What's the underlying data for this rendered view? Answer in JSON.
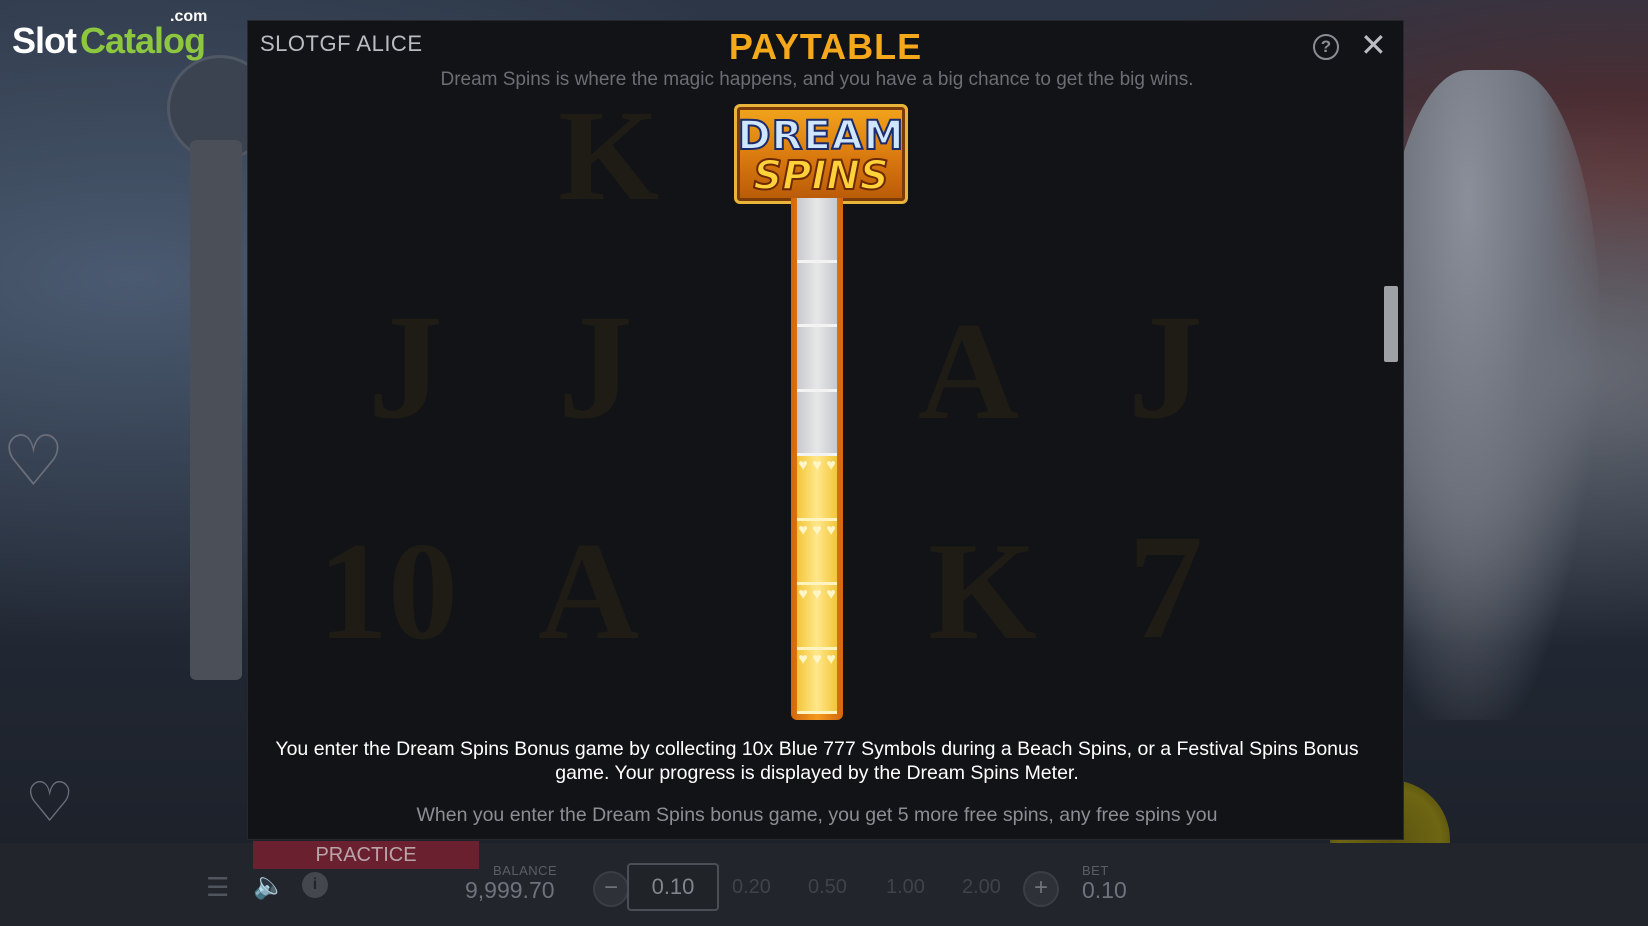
{
  "logo": {
    "com": ".com",
    "slot": "Slot",
    "catalog": "Catalog"
  },
  "paytable": {
    "game_name": "SLOTGF ALICE",
    "title": "PAYTABLE",
    "help_label": "?",
    "close_label": "✕",
    "intro": "Dream Spins is where the magic happens, and you have a big chance to get the big wins.",
    "badge": {
      "line1": "DREAM",
      "line2": "SPINS"
    },
    "meter": {
      "segments_total": 8,
      "segments_filled": 4
    },
    "description": "You enter the Dream Spins Bonus game by collecting 10x Blue 777 Symbols during a Beach Spins, or a Festival Spins Bonus game. Your progress is displayed by the Dream Spins Meter.",
    "description_next": "When you enter the Dream Spins bonus game, you get 5 more free spins, any free spins you",
    "background_symbols": [
      "K",
      "J",
      "J",
      "A",
      "J",
      "10",
      "A",
      "K",
      "7"
    ]
  },
  "bottom_bar": {
    "mode": "PRACTICE",
    "balance_label": "BALANCE",
    "balance_value": "9,999.70",
    "minus_label": "−",
    "plus_label": "+",
    "bet_current": "0.10",
    "bet_options": [
      "0.20",
      "0.50",
      "1.00",
      "2.00"
    ],
    "bet_label": "BET",
    "bet_value": "0.10"
  },
  "icons": {
    "menu": "menu-icon",
    "sound": "speaker-icon",
    "info": "info-icon"
  },
  "colors": {
    "title": "#f6a81b",
    "practice_bg": "#6b2030",
    "catalog_green": "#8dc63f",
    "meter_gold": "#f3c63a"
  }
}
